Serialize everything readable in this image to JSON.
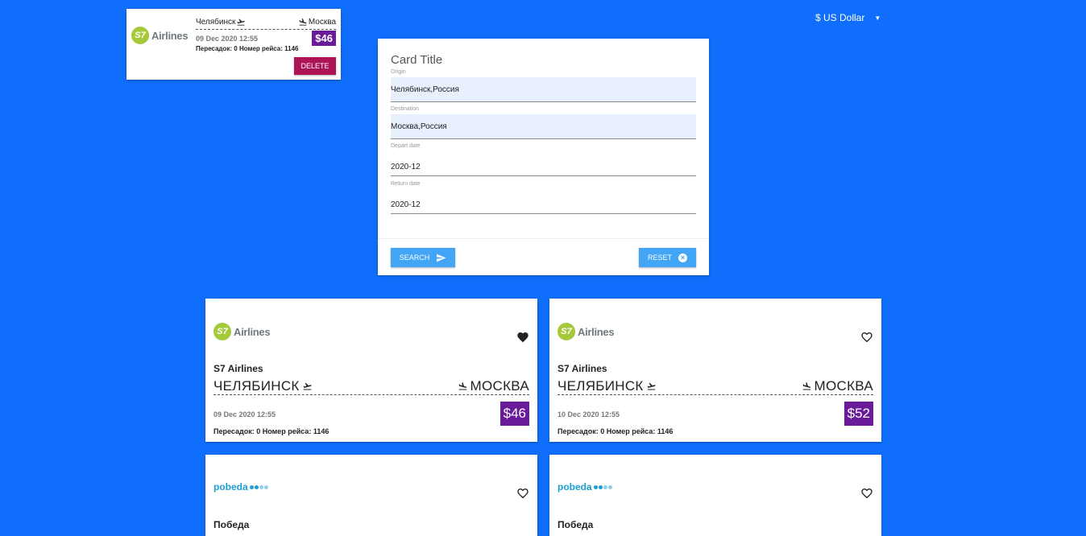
{
  "currency": {
    "label": "$ US Dollar"
  },
  "favorite": {
    "airline_logo_text": "Airlines",
    "origin": "Челябинск",
    "destination": "Москва",
    "date": "09 Dec 2020 12:55",
    "price": "$46",
    "info": "Пересадок: 0 Номер рейса: 1146",
    "delete_label": "DELETE"
  },
  "form": {
    "title": "Card Title",
    "fields": [
      {
        "label": "Origin",
        "value": "Челябинск,Россия"
      },
      {
        "label": "Destination",
        "value": "Москва,Россия"
      },
      {
        "label": "Depart date",
        "value": "2020-12"
      },
      {
        "label": "Return date",
        "value": "2020-12"
      }
    ],
    "search_label": "SEARCH",
    "reset_label": "RESET"
  },
  "tickets": [
    {
      "logo_text": "Airlines",
      "airline": "S7 Airlines",
      "origin": "ЧЕЛЯБИНСК",
      "destination": "МОСКВА",
      "date": "09 Dec 2020 12:55",
      "price": "$46",
      "info": "Пересадок: 0 Номер рейса: 1146",
      "favorited": true
    },
    {
      "logo_text": "Airlines",
      "airline": "S7 Airlines",
      "origin": "ЧЕЛЯБИНСК",
      "destination": "МОСКВА",
      "date": "10 Dec 2020 12:55",
      "price": "$52",
      "info": "Пересадок: 0 Номер рейса: 1146",
      "favorited": false
    },
    {
      "logo_text": "pobeda",
      "airline": "Победа",
      "favorited": false
    },
    {
      "logo_text": "pobeda",
      "airline": "Победа",
      "favorited": false
    }
  ],
  "colors": {
    "background": "#0f6ffc",
    "price": "#6a1b9a",
    "delete": "#ad1457",
    "button": "#42a5f5"
  }
}
